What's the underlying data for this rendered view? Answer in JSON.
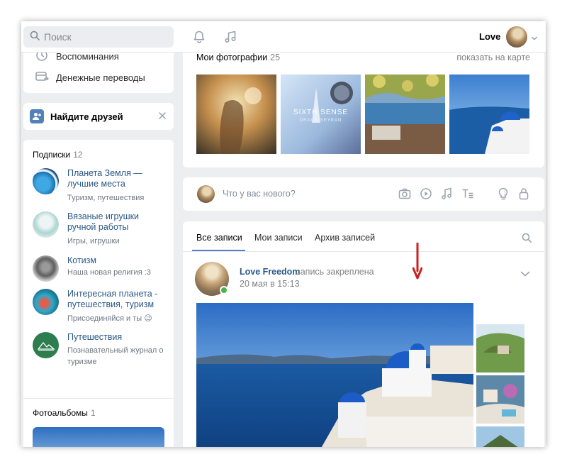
{
  "header": {
    "search_placeholder": "Поиск",
    "user_name": "Love",
    "icons": [
      "bell-icon",
      "music-icon",
      "chevron-down-icon"
    ]
  },
  "left_menu": {
    "items": [
      {
        "label": "Воспоминания",
        "icon": "clock-icon"
      },
      {
        "label": "Денежные переводы",
        "icon": "money-transfer-icon"
      }
    ]
  },
  "find_friends": {
    "label": "Найдите друзей",
    "icon": "add-friend-icon"
  },
  "subscriptions": {
    "title": "Подписки",
    "count": "12",
    "items": [
      {
        "title": "Планета Земля — лучшие места",
        "desc": "Туризм, путешествия"
      },
      {
        "title": "Вязаные игрушки ручной работы",
        "desc": "Игры, игрушки"
      },
      {
        "title": "Котизм",
        "desc": "Наша новая религия :3"
      },
      {
        "title": "Интересная планета - путешествия, туризм",
        "desc": "Присоединяйся и ты 😉"
      },
      {
        "title": "Путешествия",
        "desc": "Познавательный журнал о туризме"
      }
    ]
  },
  "albums": {
    "title": "Фотоальбомы",
    "count": "1"
  },
  "photos": {
    "title": "Мои фотографии",
    "count": "25",
    "map_link": "показать на карте",
    "photo2_text": "SIXTH SENSE",
    "photo2_sub": "DRAGE SEYEAN"
  },
  "composer": {
    "placeholder": "Что у вас нового?",
    "icons": [
      "camera-icon",
      "video-icon",
      "music-note-icon",
      "text-format-icon",
      "lightbulb-icon",
      "lock-icon"
    ]
  },
  "feed": {
    "tabs": [
      {
        "label": "Все записи",
        "active": true
      },
      {
        "label": "Мои записи",
        "active": false
      },
      {
        "label": "Архив записей",
        "active": false
      }
    ]
  },
  "post": {
    "author": "Love Freedom",
    "status": "запись закреплена",
    "date": "20 мая в 15:13"
  },
  "colors": {
    "accent": "#5181b8",
    "link": "#2a5885",
    "muted": "#828282",
    "online": "#4bb34b",
    "annotation_arrow": "#cc1f1f"
  }
}
